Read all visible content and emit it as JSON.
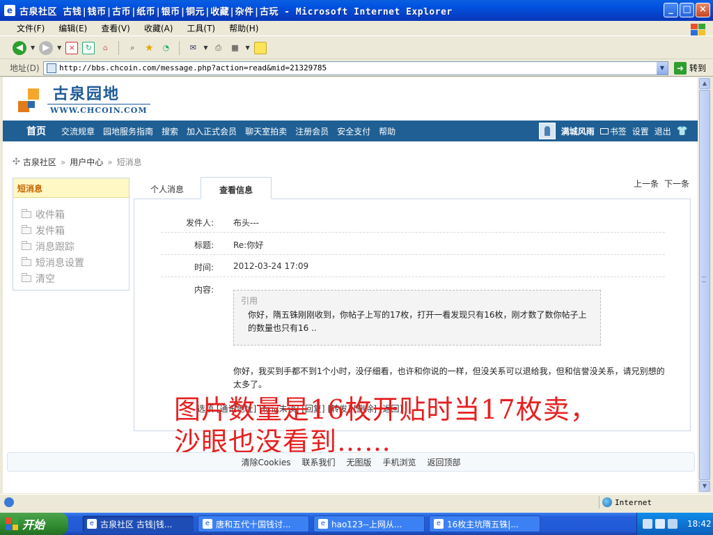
{
  "window": {
    "title": "古泉社区 古钱|钱币|古币|纸币|银币|铜元|收藏|杂件|古玩 - Microsoft Internet Explorer"
  },
  "menu": [
    "文件(F)",
    "编辑(E)",
    "查看(V)",
    "收藏(A)",
    "工具(T)",
    "帮助(H)"
  ],
  "toolbar": {
    "icons": [
      "back-icon",
      "forward-icon",
      "stop-icon",
      "refresh-icon",
      "home-icon",
      "search-icon",
      "favorites-icon",
      "history-icon",
      "mail-icon",
      "print-icon",
      "edit-icon",
      "discuss-icon"
    ]
  },
  "address": {
    "label": "地址(D)",
    "url": "http://bbs.chcoin.com/message.php?action=read&mid=21329785",
    "go_label": "转到"
  },
  "site": {
    "logo_title": "古泉园地",
    "logo_sub": "WWW.CHCOIN.COM",
    "nav_home": "首页",
    "nav_links": [
      "交流规章",
      "园地服务指南",
      "搜索",
      "加入正式会员",
      "聊天室拍卖",
      "注册会员",
      "安全支付",
      "帮助"
    ],
    "user_name": "满城风雨",
    "user_links": [
      "书签",
      "设置",
      "退出"
    ]
  },
  "breadcrumb": {
    "items": [
      "古泉社区",
      "用户中心"
    ],
    "current": "短消息"
  },
  "sidebar": {
    "title": "短消息",
    "items": [
      "收件箱",
      "发件箱",
      "消息跟踪",
      "短消息设置",
      "清空"
    ]
  },
  "tabs": [
    "个人消息",
    "查看信息"
  ],
  "pager": {
    "prev": "上一条",
    "next": "下一条"
  },
  "message": {
    "sender_label": "发件人:",
    "sender": "布头---",
    "subject_label": "标题:",
    "subject": "Re:你好",
    "time_label": "时间:",
    "time": "2012-03-24 17:09",
    "content_label": "内容:",
    "quote_label": "引用",
    "quote_text": "你好，隋五铢刚刚收到，你帖子上写的17枚，打开一看发现只有16枚，刚才数了数你帖子上的数量也只有16 ..",
    "reply_text": "你好，我买到手都不到1个小时，没仔细看，也许和你说的一样，但没关系可以退给我，但和信誉没关系，请兄别想的太多了。",
    "actions_prefix": "选项",
    "actions": [
      "[通讯地址]",
      "[标记未读]",
      "[回复]",
      "[转发]",
      "[删除]",
      "[返回]"
    ]
  },
  "overlay": {
    "line1": "图片数量是16枚开贴时当17枚卖，",
    "line2": "沙眼也没看到……"
  },
  "footer": [
    "清除Cookies",
    "联系我们",
    "无图版",
    "手机浏览",
    "返回顶部"
  ],
  "statusbar": {
    "zone": "Internet"
  },
  "taskbar": {
    "start": "开始",
    "tasks": [
      "古泉社区 古钱|钱...",
      "唐和五代十国钱讨...",
      "hao123--上网从...",
      "16枚主坑隋五铢|..."
    ],
    "clock": "18:42"
  }
}
